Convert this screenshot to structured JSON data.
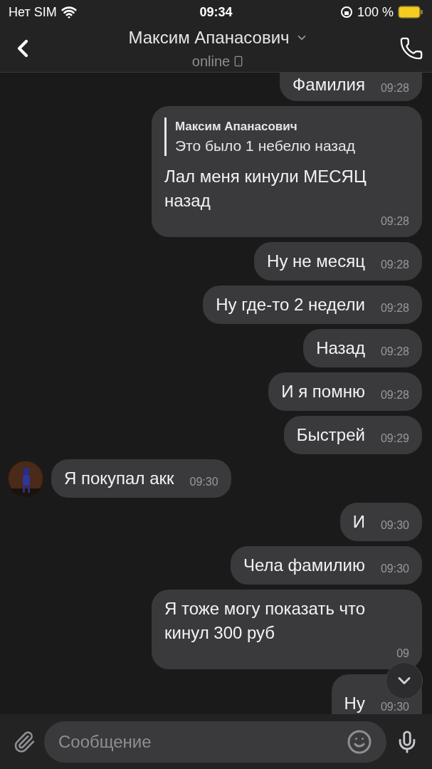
{
  "status_bar": {
    "carrier": "Нет SIM",
    "time": "09:34",
    "battery": "100 %"
  },
  "header": {
    "name": "Максим Апанасович",
    "status": "online"
  },
  "messages": [
    {
      "kind": "outgoing",
      "text": "Фамилия",
      "time": "09:28",
      "cut_top": true
    },
    {
      "kind": "outgoing",
      "text": "Лал меня кинули МЕСЯЦ назад",
      "time": "09:28",
      "reply": {
        "author": "Максим Апанасович",
        "text": "Это было 1 небелю назад"
      }
    },
    {
      "kind": "outgoing",
      "text": "Ну не месяц",
      "time": "09:28"
    },
    {
      "kind": "outgoing",
      "text": "Ну где-то 2 недели",
      "time": "09:28"
    },
    {
      "kind": "outgoing",
      "text": "Назад",
      "time": "09:28"
    },
    {
      "kind": "outgoing",
      "text": "И я помню",
      "time": "09:28"
    },
    {
      "kind": "outgoing",
      "text": "Быстрей",
      "time": "09:29"
    },
    {
      "kind": "incoming",
      "text": "Я покупал акк",
      "time": "09:30"
    },
    {
      "kind": "outgoing",
      "text": "И",
      "time": "09:30"
    },
    {
      "kind": "outgoing",
      "text": "Чела фамилию",
      "time": "09:30"
    },
    {
      "kind": "outgoing",
      "text": "Я тоже могу показать что кинул 300 руб",
      "time": "09"
    },
    {
      "kind": "outgoing",
      "text": "Ну",
      "time": "09:30",
      "cut_bottom": true
    }
  ],
  "composer": {
    "placeholder": "Сообщение"
  }
}
